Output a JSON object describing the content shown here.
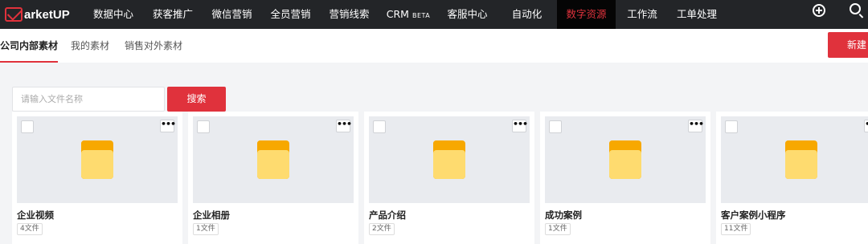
{
  "brand": {
    "logo_text": "arketUP",
    "accent": "#e0323c"
  },
  "nav": {
    "items": [
      {
        "label": "数据中心"
      },
      {
        "label": "获客推广"
      },
      {
        "label": "微信营销"
      },
      {
        "label": "全员营销"
      },
      {
        "label": "营销线索"
      },
      {
        "label": "CRM",
        "badge": "BETA"
      },
      {
        "label": "客服中心"
      },
      {
        "label": "自动化"
      },
      {
        "label": "数字资源",
        "active": true
      },
      {
        "label": "工作流"
      },
      {
        "label": "工单处理"
      }
    ],
    "icons": [
      "add-circle-icon",
      "search-icon"
    ]
  },
  "tabs": [
    {
      "label": "公司内部素材",
      "active": true
    },
    {
      "label": "我的素材"
    },
    {
      "label": "销售对外素材"
    }
  ],
  "new_button_label": "新建",
  "search": {
    "placeholder": "请输入文件名称",
    "value": "",
    "button_label": "搜索"
  },
  "folders": [
    {
      "name": "企业视频",
      "count": "4文件"
    },
    {
      "name": "企业相册",
      "count": "1文件"
    },
    {
      "name": "产品介绍",
      "count": "2文件"
    },
    {
      "name": "成功案例",
      "count": "1文件"
    },
    {
      "name": "客户案例小程序",
      "count": "11文件"
    }
  ],
  "more_icon_glyph": "•••"
}
